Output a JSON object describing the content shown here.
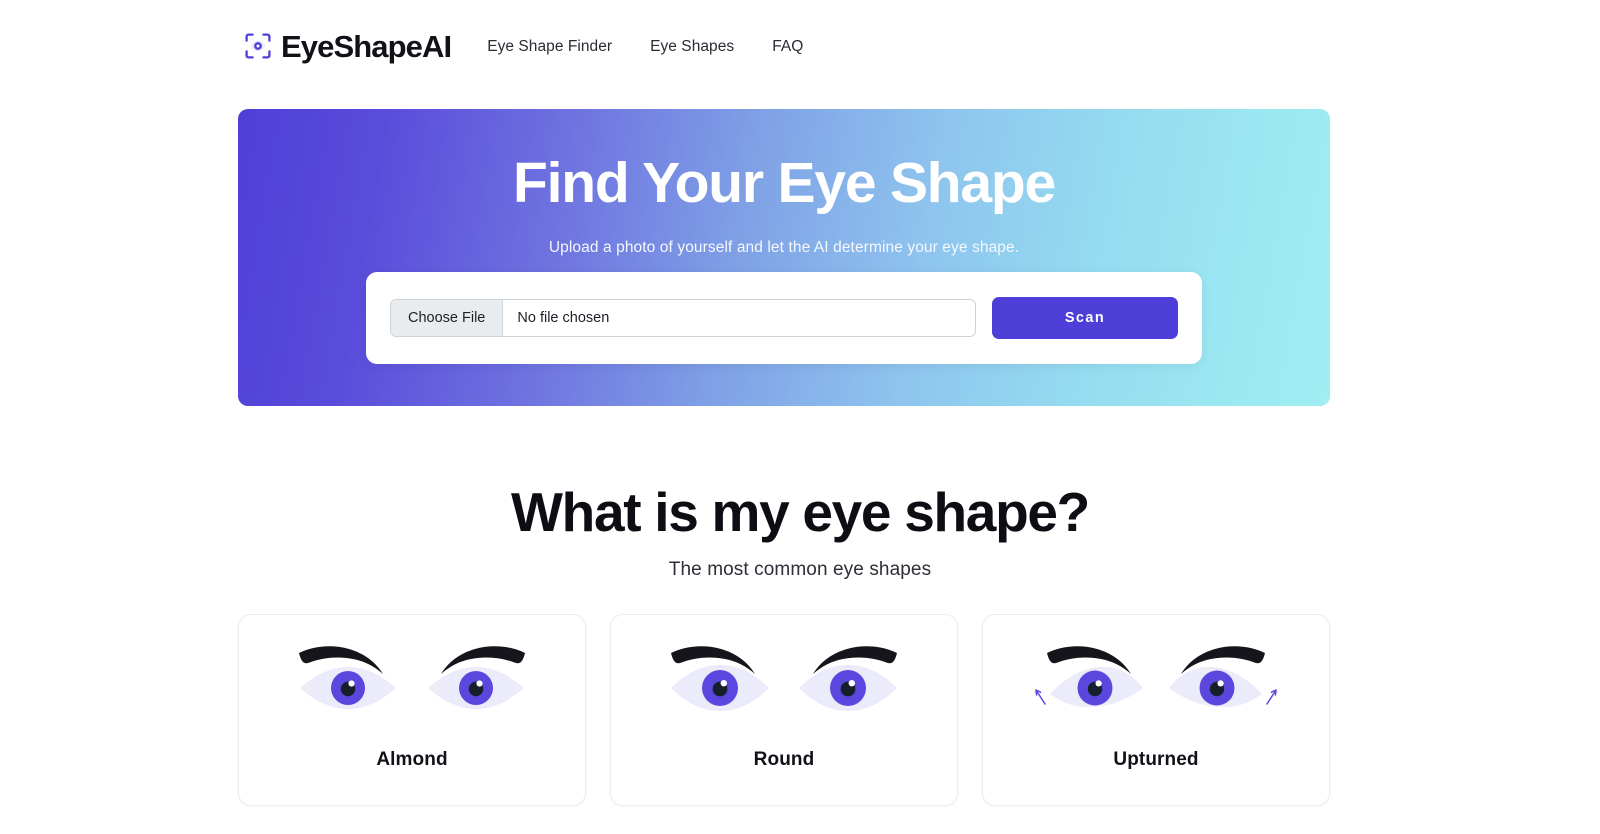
{
  "brand": {
    "name": "EyeShapeAI",
    "icon": "eye-scan-icon",
    "accent_color": "#4F3FD9"
  },
  "nav": {
    "items": [
      {
        "label": "Eye Shape Finder"
      },
      {
        "label": "Eye Shapes"
      },
      {
        "label": "FAQ"
      }
    ]
  },
  "hero": {
    "title": "Find Your Eye Shape",
    "subtitle": "Upload a photo of yourself and let the AI determine your eye shape.",
    "gradient_from": "#4F3FD9",
    "gradient_to": "#A0EDF2"
  },
  "upload": {
    "choose_file_label": "Choose File",
    "file_name_value": "No file chosen",
    "file_name_placeholder": "No file chosen",
    "scan_label": "Scan",
    "scan_color": "#4F3FD9"
  },
  "section": {
    "title": "What is my eye shape?",
    "subtitle": "The most common eye shapes"
  },
  "shapes": {
    "cards": [
      {
        "label": "Almond",
        "art": "almond-eyes-illustration"
      },
      {
        "label": "Round",
        "art": "round-eyes-illustration"
      },
      {
        "label": "Upturned",
        "art": "upturned-eyes-illustration"
      }
    ],
    "iris_color": "#5B47DE",
    "sclera_color": "#ECEBFA",
    "brow_color": "#15151B"
  }
}
